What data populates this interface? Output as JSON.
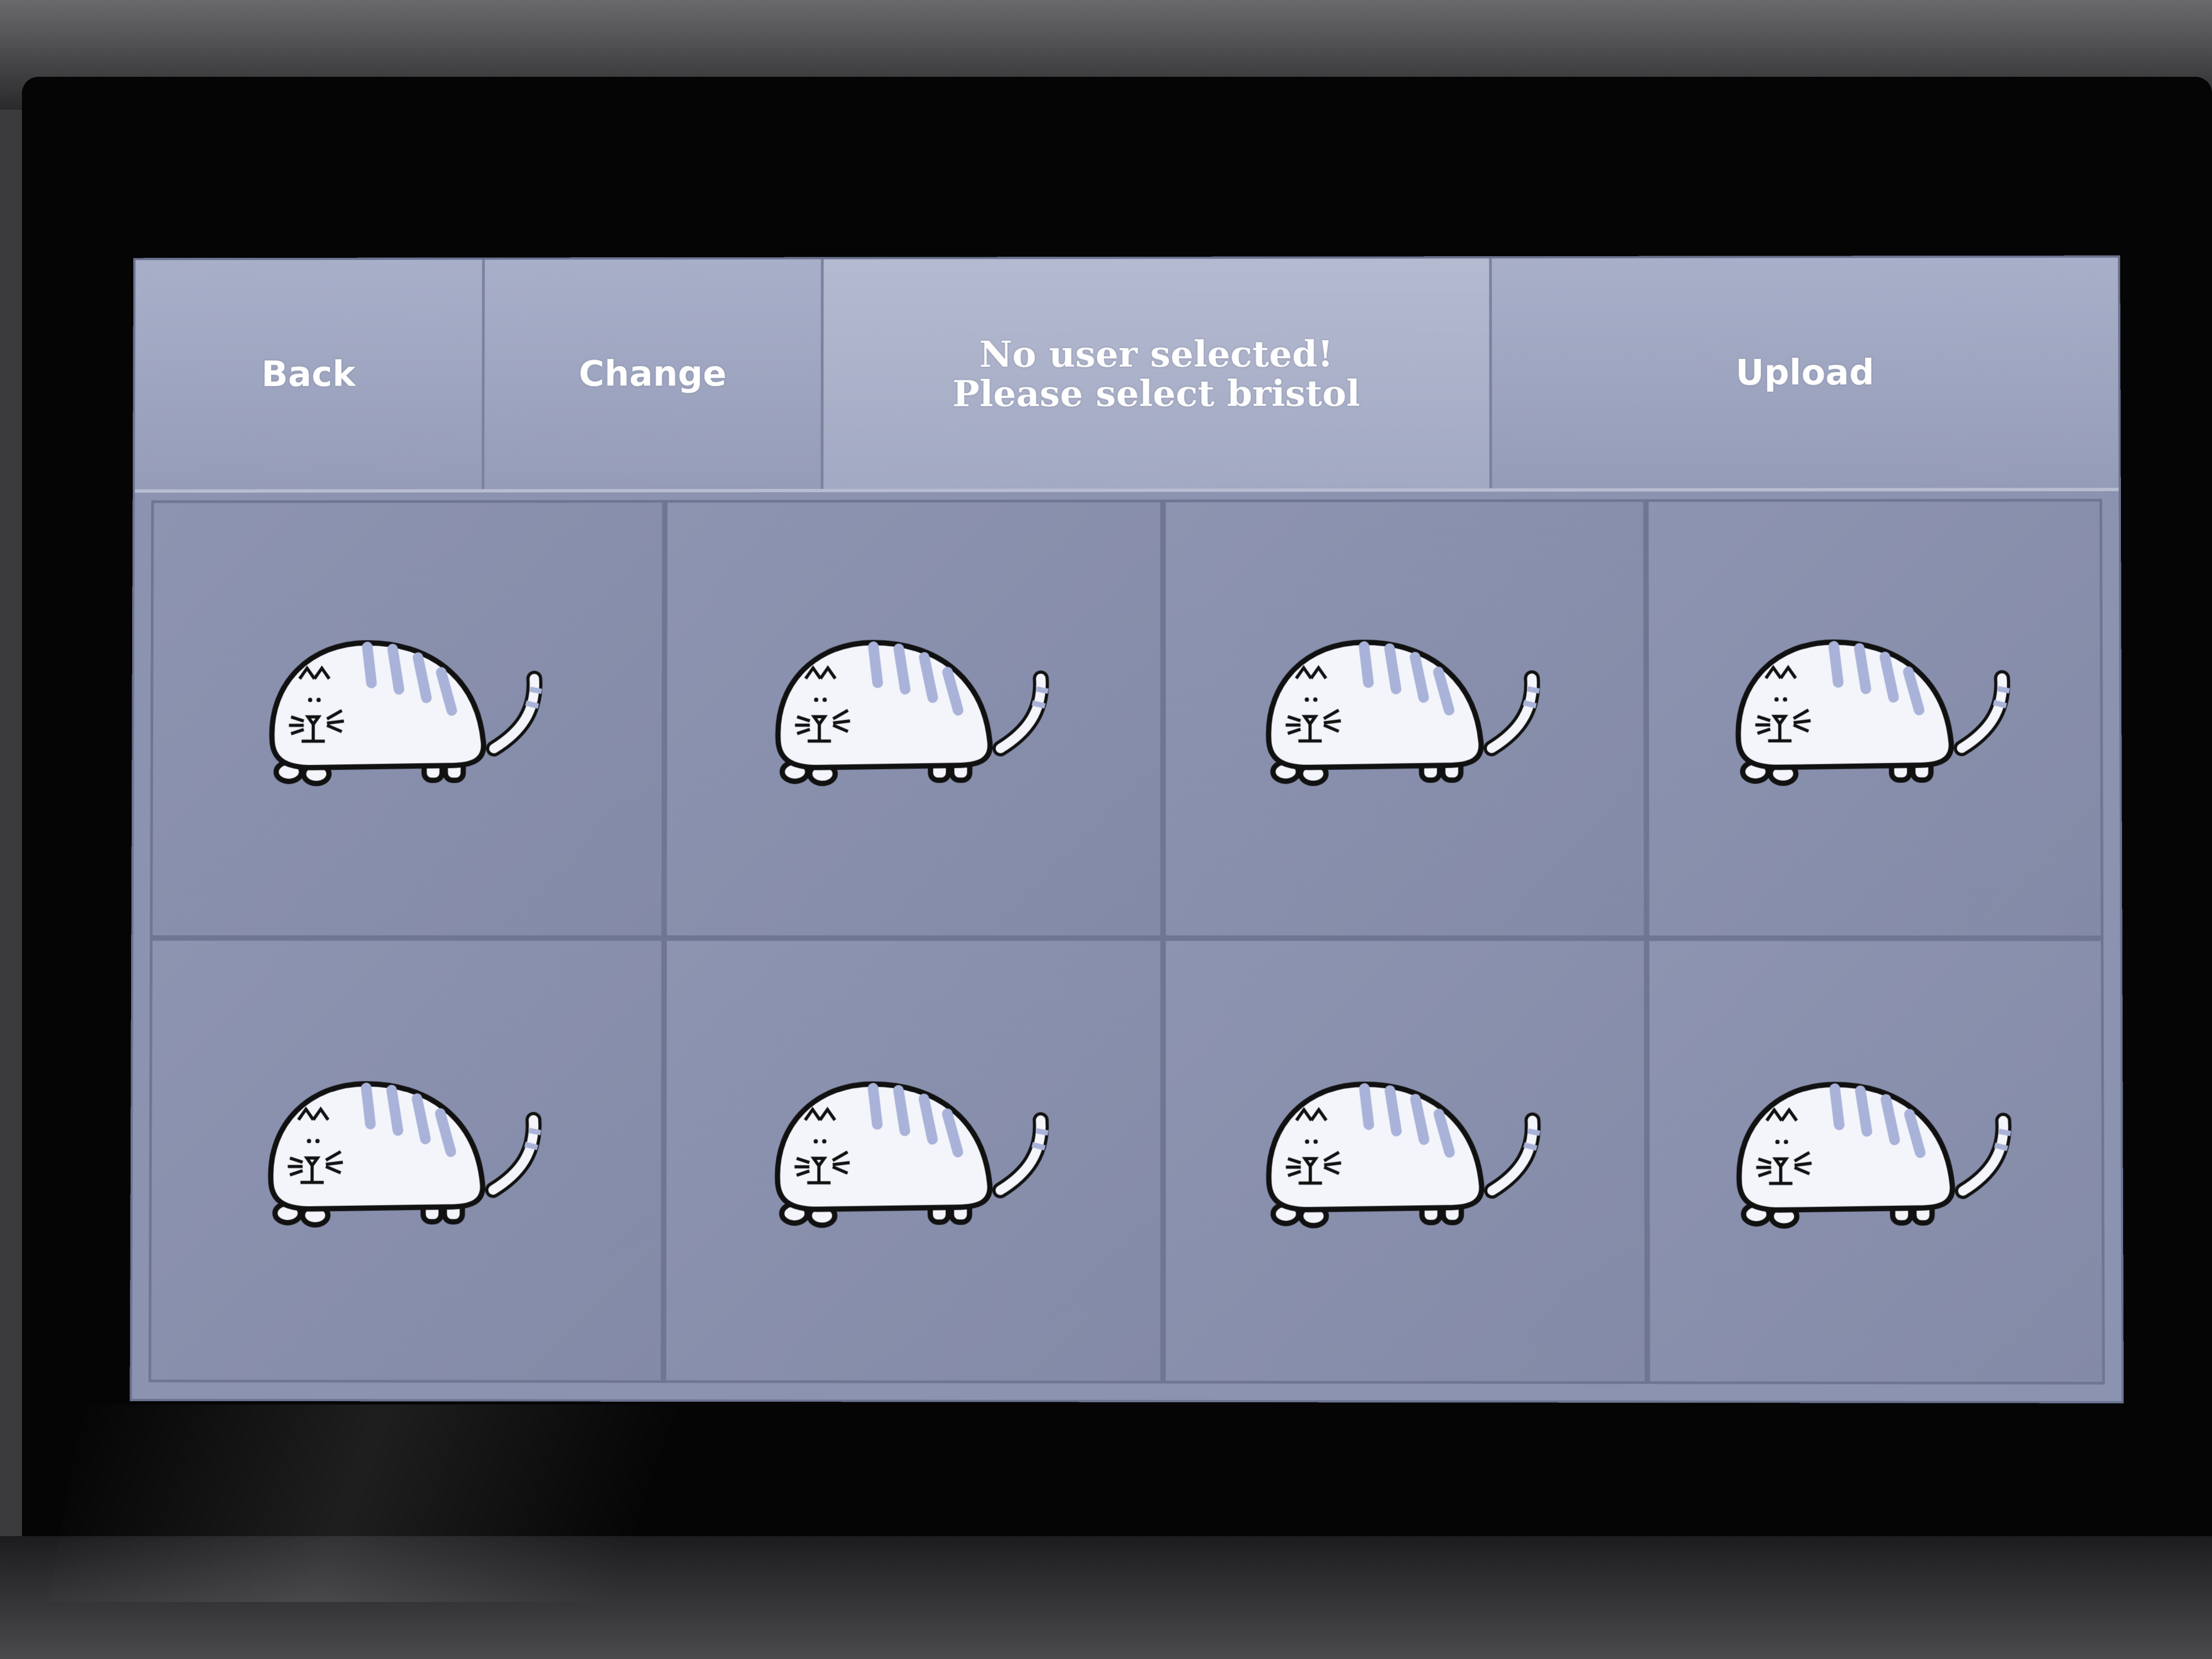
{
  "header": {
    "back_label": "Back",
    "change_label": "Change",
    "status_line1": "No user selected!",
    "status_line2": "Please select bristol",
    "upload_label": "Upload"
  },
  "tiles": [
    {
      "icon": "cat-icon"
    },
    {
      "icon": "cat-icon"
    },
    {
      "icon": "cat-icon"
    },
    {
      "icon": "cat-icon"
    },
    {
      "icon": "cat-icon"
    },
    {
      "icon": "cat-icon"
    },
    {
      "icon": "cat-icon"
    },
    {
      "icon": "cat-icon"
    }
  ],
  "colors": {
    "screen_background": "#8c93b0",
    "button_text": "#ffffff",
    "tile_border": "#6f7693",
    "cat_stripes": "#a9b2d8"
  }
}
